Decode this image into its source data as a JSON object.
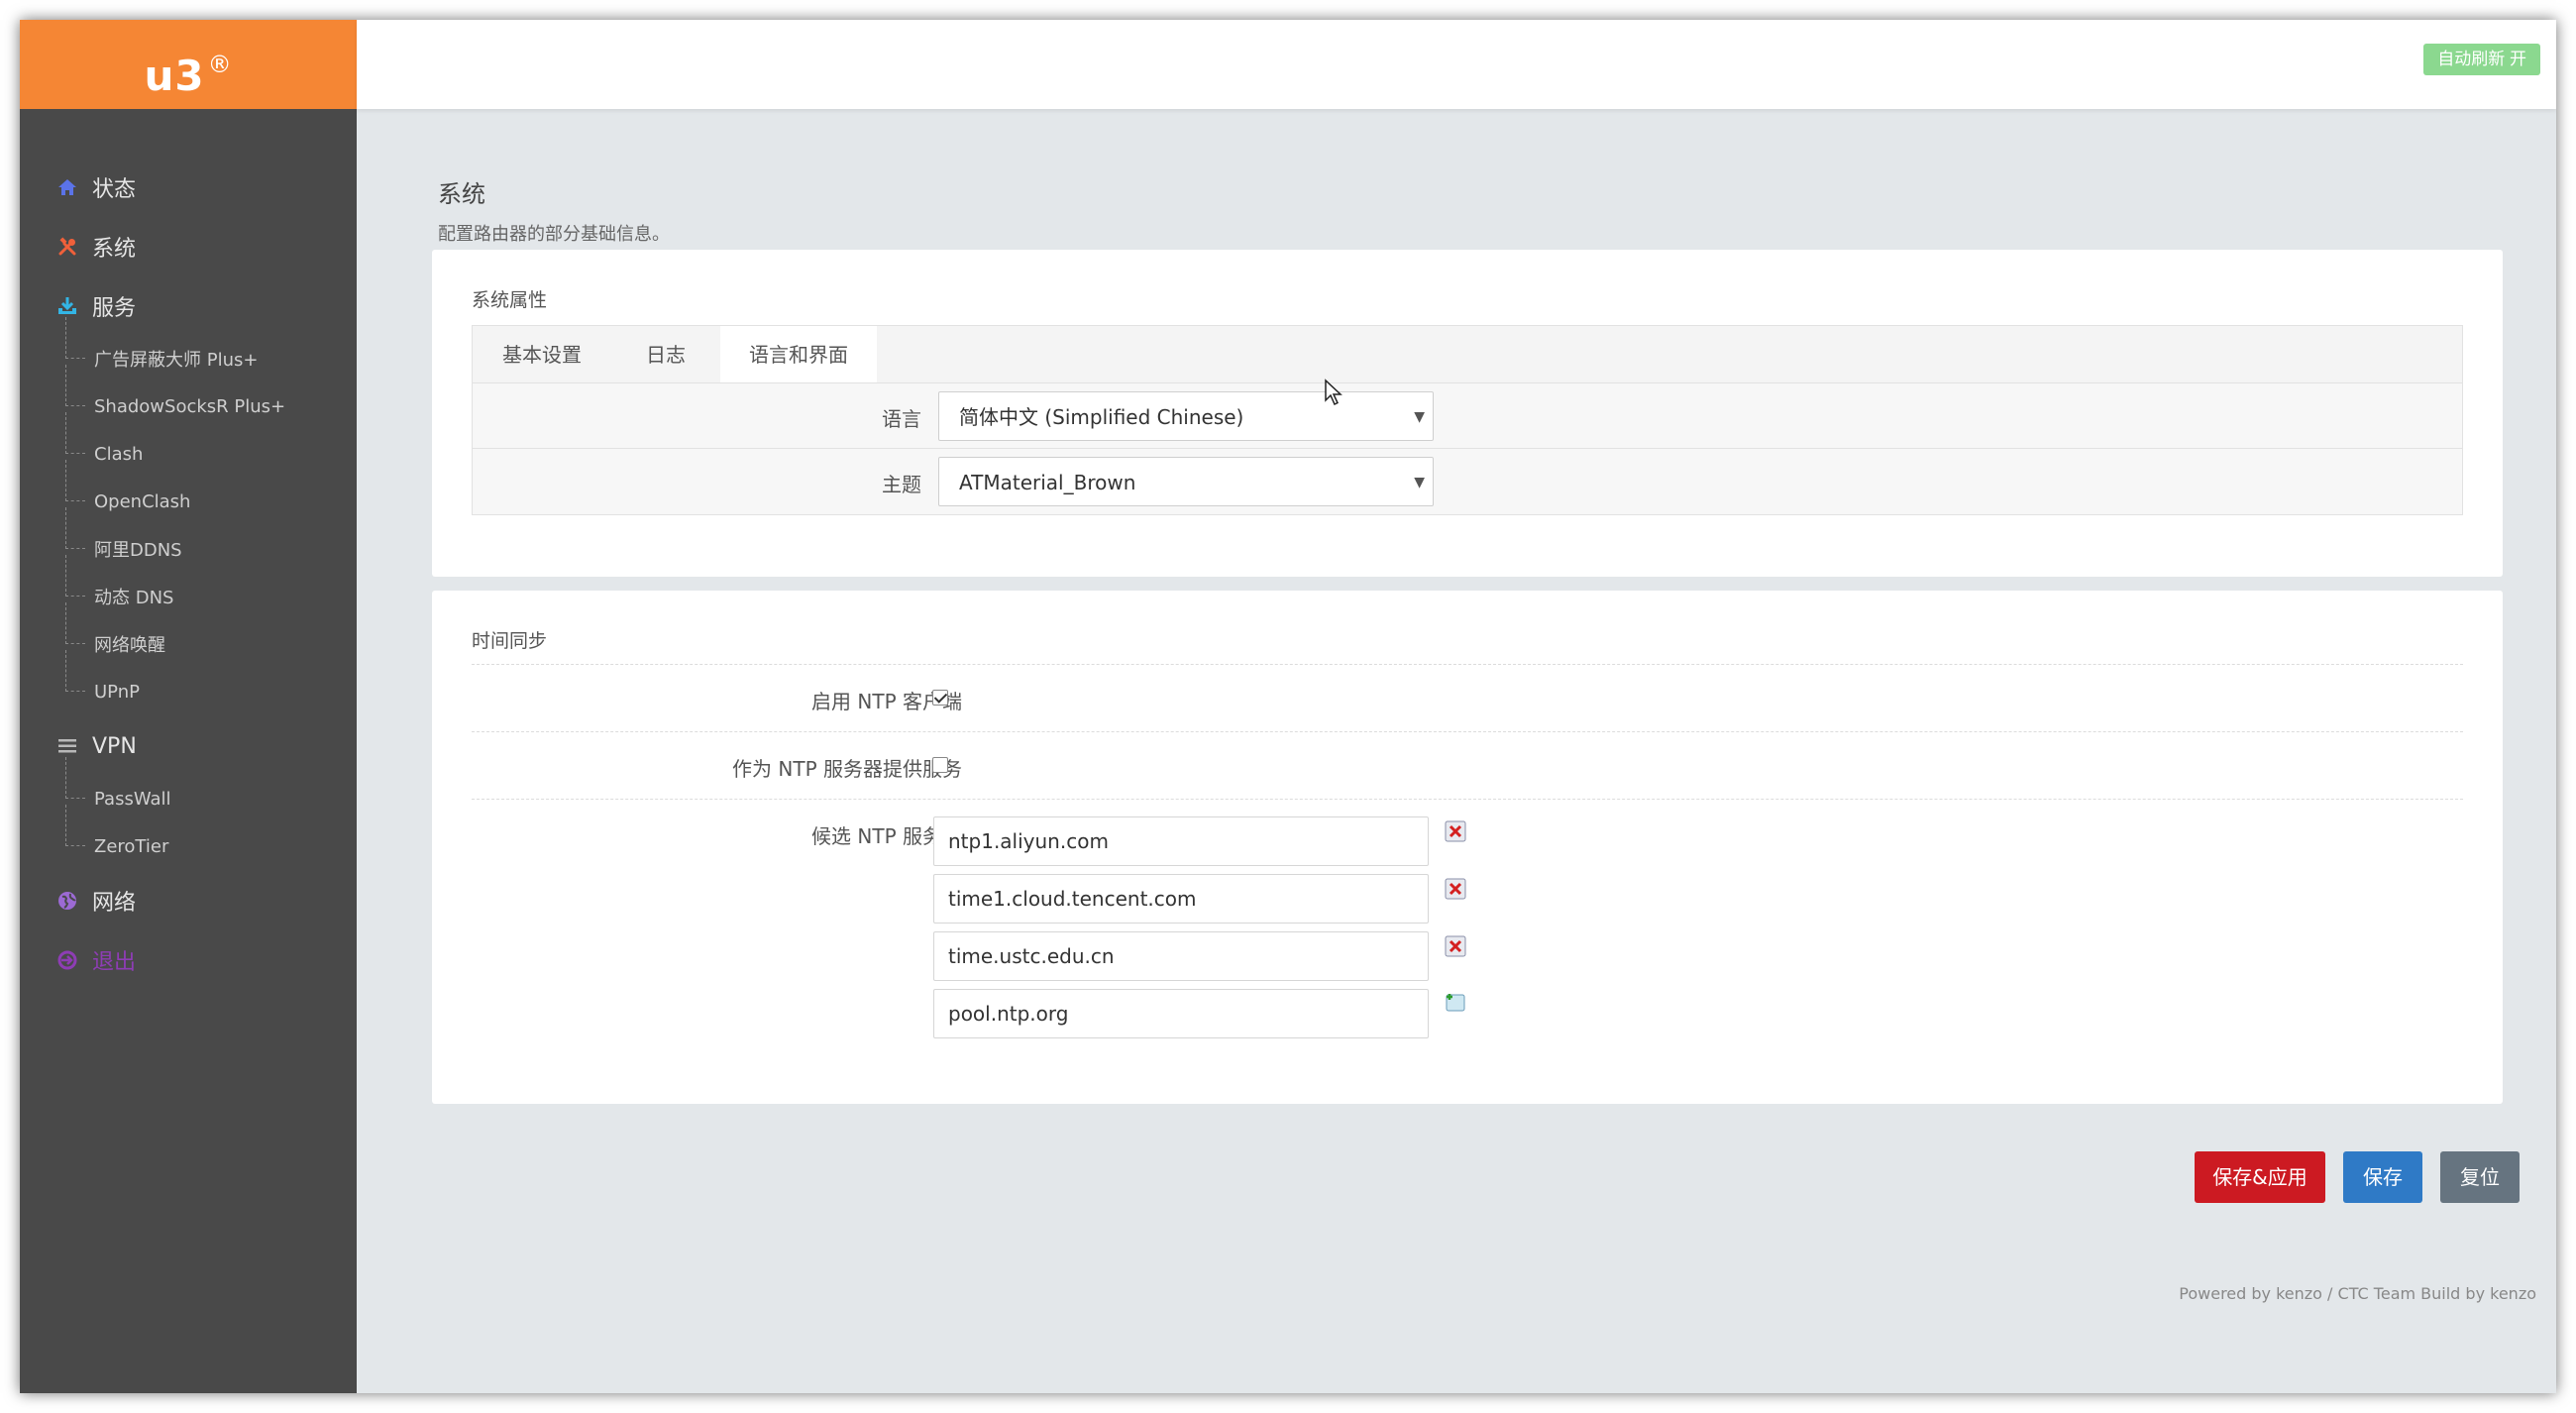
{
  "brand": {
    "name": "u3",
    "mark": "®",
    "color": "#f58634"
  },
  "topbar": {
    "auto_refresh": "自动刷新 开"
  },
  "sidebar": {
    "menus": [
      {
        "label": "状态",
        "icon": "home-icon",
        "color": "#5b73e8"
      },
      {
        "label": "系统",
        "icon": "tools-icon",
        "color": "#f0603a"
      },
      {
        "label": "服务",
        "icon": "download-icon",
        "color": "#33b5e5"
      },
      {
        "label": "VPN",
        "icon": "list-icon",
        "color": "#b8b8b8"
      },
      {
        "label": "网络",
        "icon": "globe-icon",
        "color": "#9c6ad4"
      },
      {
        "label": "退出",
        "icon": "logout-icon",
        "color": "#8e3db5"
      }
    ],
    "services": [
      "广告屏蔽大师 Plus+",
      "ShadowSocksR Plus+",
      "Clash",
      "OpenClash",
      "阿里DDNS",
      "动态 DNS",
      "网络唤醒",
      "UPnP"
    ],
    "vpn": [
      "PassWall",
      "ZeroTier"
    ]
  },
  "page": {
    "title": "系统",
    "description": "配置路由器的部分基础信息。"
  },
  "system_props": {
    "legend": "系统属性",
    "tabs": [
      "基本设置",
      "日志",
      "语言和界面"
    ],
    "active_tab": "语言和界面",
    "language_label": "语言",
    "language_value": "简体中文 (Simplified Chinese)",
    "theme_label": "主题",
    "theme_value": "ATMaterial_Brown"
  },
  "time_sync": {
    "legend": "时间同步",
    "ntp_client_label": "启用 NTP 客户端",
    "ntp_client_checked": true,
    "ntp_server_label": "作为 NTP 服务器提供服务",
    "ntp_server_checked": false,
    "candidates_label": "候选 NTP 服务器",
    "servers": [
      "ntp1.aliyun.com",
      "time1.cloud.tencent.com",
      "time.ustc.edu.cn",
      "pool.ntp.org"
    ]
  },
  "actions": {
    "save_apply": "保存&应用",
    "save": "保存",
    "reset": "复位"
  },
  "footer": "Powered by kenzo / CTC Team Build by kenzo"
}
